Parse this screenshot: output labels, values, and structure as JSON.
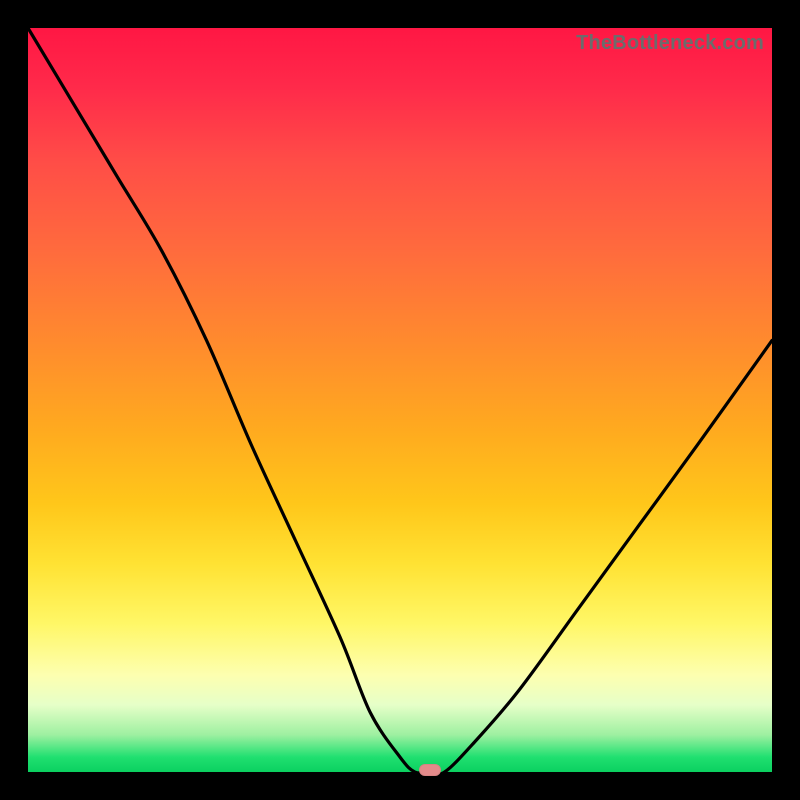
{
  "watermark": "TheBottleneck.com",
  "chart_data": {
    "type": "line",
    "title": "",
    "xlabel": "",
    "ylabel": "",
    "xlim": [
      0,
      100
    ],
    "ylim": [
      0,
      100
    ],
    "series": [
      {
        "name": "bottleneck-curve",
        "x": [
          0,
          6,
          12,
          18,
          24,
          30,
          36,
          42,
          46,
          50,
          52,
          54,
          56,
          60,
          66,
          74,
          82,
          90,
          100
        ],
        "y": [
          100,
          90,
          80,
          70,
          58,
          44,
          31,
          18,
          8,
          2,
          0,
          0,
          0,
          4,
          11,
          22,
          33,
          44,
          58
        ]
      }
    ],
    "annotations": [
      {
        "name": "min-marker",
        "x": 54,
        "y": 0
      }
    ],
    "background_gradient": {
      "top": "#ff1744",
      "mid": "#ffcc00",
      "bottom": "#0bd060"
    }
  },
  "marker": {
    "color": "#e38a8a"
  }
}
